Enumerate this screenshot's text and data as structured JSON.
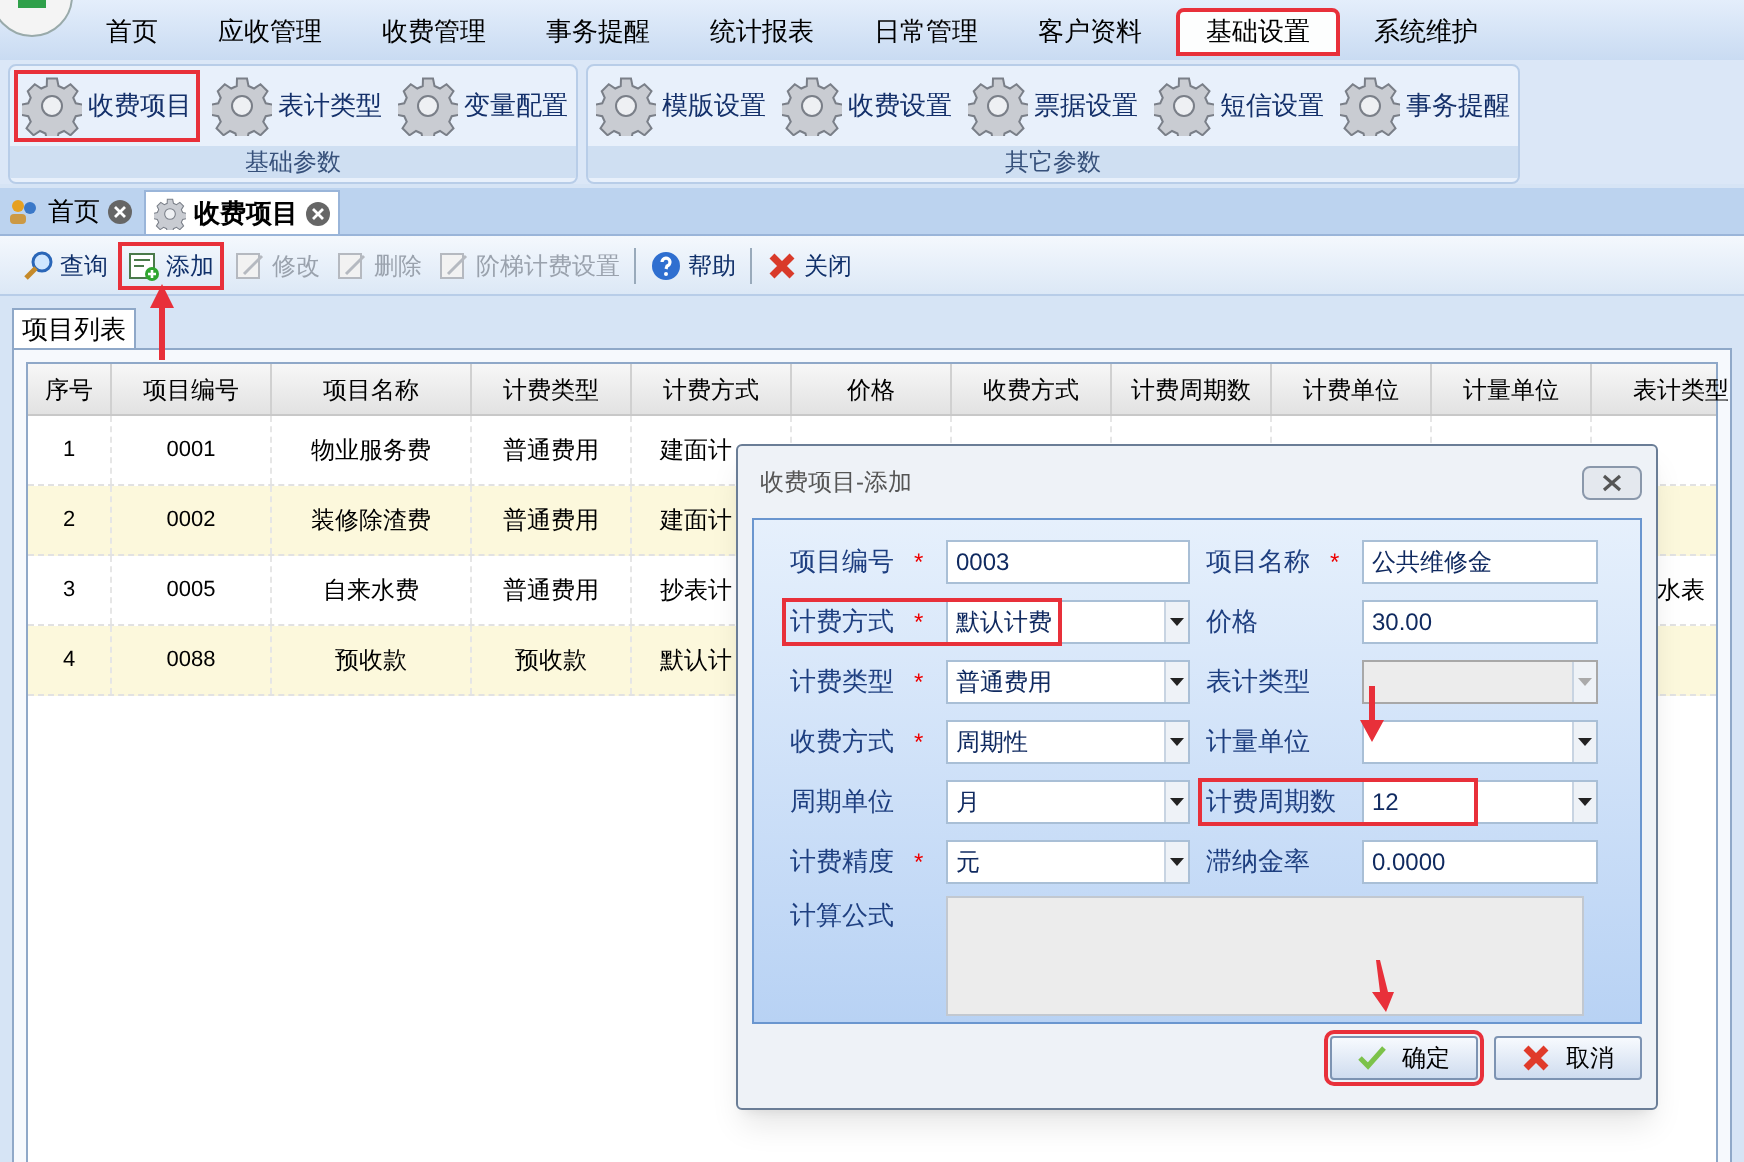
{
  "menu": [
    {
      "label": "首页",
      "selected": false
    },
    {
      "label": "应收管理",
      "selected": false
    },
    {
      "label": "收费管理",
      "selected": false
    },
    {
      "label": "事务提醒",
      "selected": false
    },
    {
      "label": "统计报表",
      "selected": false
    },
    {
      "label": "日常管理",
      "selected": false
    },
    {
      "label": "客户资料",
      "selected": false
    },
    {
      "label": "基础设置",
      "selected": true
    },
    {
      "label": "系统维护",
      "selected": false
    }
  ],
  "ribbon_groups": [
    {
      "title": "基础参数",
      "items": [
        {
          "label": "收费项目",
          "selected": true
        },
        {
          "label": "表计类型",
          "selected": false
        },
        {
          "label": "变量配置",
          "selected": false
        }
      ]
    },
    {
      "title": "其它参数",
      "items": [
        {
          "label": "模版设置",
          "selected": false
        },
        {
          "label": "收费设置",
          "selected": false
        },
        {
          "label": "票据设置",
          "selected": false
        },
        {
          "label": "短信设置",
          "selected": false
        },
        {
          "label": "事务提醒",
          "selected": false
        }
      ]
    }
  ],
  "doc_tabs": [
    {
      "label": "首页",
      "selected": false
    },
    {
      "label": "收费项目",
      "selected": true
    }
  ],
  "toolbar": [
    {
      "label": "查询",
      "disabled": false,
      "highlighted": false
    },
    {
      "label": "添加",
      "disabled": false,
      "highlighted": true
    },
    {
      "label": "修改",
      "disabled": true,
      "highlighted": false
    },
    {
      "label": "删除",
      "disabled": true,
      "highlighted": false
    },
    {
      "label": "阶梯计费设置",
      "disabled": true,
      "highlighted": false
    },
    {
      "label": "帮助",
      "disabled": false,
      "highlighted": false
    },
    {
      "label": "关闭",
      "disabled": false,
      "highlighted": false
    }
  ],
  "panel_tab": "项目列表",
  "table": {
    "columns": [
      "序号",
      "项目编号",
      "项目名称",
      "计费类型",
      "计费方式",
      "价格",
      "收费方式",
      "计费周期数",
      "计费单位",
      "计量单位",
      "表计类型"
    ],
    "rows": [
      [
        "1",
        "0001",
        "物业服务费",
        "普通费用",
        "建面计",
        null,
        null,
        null,
        null,
        null,
        null
      ],
      [
        "2",
        "0002",
        "装修除渣费",
        "普通费用",
        "建面计",
        null,
        null,
        null,
        null,
        null,
        null
      ],
      [
        "3",
        "0005",
        "自来水费",
        "普通费用",
        "抄表计",
        null,
        null,
        null,
        null,
        null,
        "水表"
      ],
      [
        "4",
        "0088",
        "预收款",
        "预收款",
        "默认计",
        null,
        null,
        null,
        null,
        null,
        null
      ]
    ]
  },
  "dialog": {
    "title": "收费项目-添加",
    "fields": [
      {
        "label": "项目编号",
        "required_mark": "*",
        "kind": "text",
        "value": "0003"
      },
      {
        "label": "项目名称",
        "required_mark": "*",
        "kind": "text",
        "value": "公共维修金"
      },
      {
        "label": "计费方式",
        "required_mark": "*",
        "kind": "select",
        "value": "默认计费",
        "highlighted": true
      },
      {
        "label": "价格",
        "kind": "text",
        "value": "30.00"
      },
      {
        "label": "计费类型",
        "required_mark": "*",
        "kind": "select",
        "value": "普通费用"
      },
      {
        "label": "表计类型",
        "kind": "select",
        "disabled": true
      },
      {
        "label": "收费方式",
        "required_mark": "*",
        "kind": "select",
        "value": "周期性"
      },
      {
        "label": "计量单位",
        "kind": "select"
      },
      {
        "label": "周期单位",
        "kind": "select",
        "value": "月"
      },
      {
        "label": "计费周期数",
        "kind": "select",
        "value": "12",
        "highlighted": true
      },
      {
        "label": "计费精度",
        "required_mark": "*",
        "kind": "select",
        "value": "元"
      },
      {
        "label": "滞纳金率",
        "kind": "text",
        "value": "0.0000"
      }
    ],
    "formula_label": "计算公式",
    "buttons": [
      {
        "label": "确定",
        "kind": "ok",
        "highlighted": true
      },
      {
        "label": "取消",
        "kind": "cancel",
        "highlighted": false
      }
    ]
  }
}
